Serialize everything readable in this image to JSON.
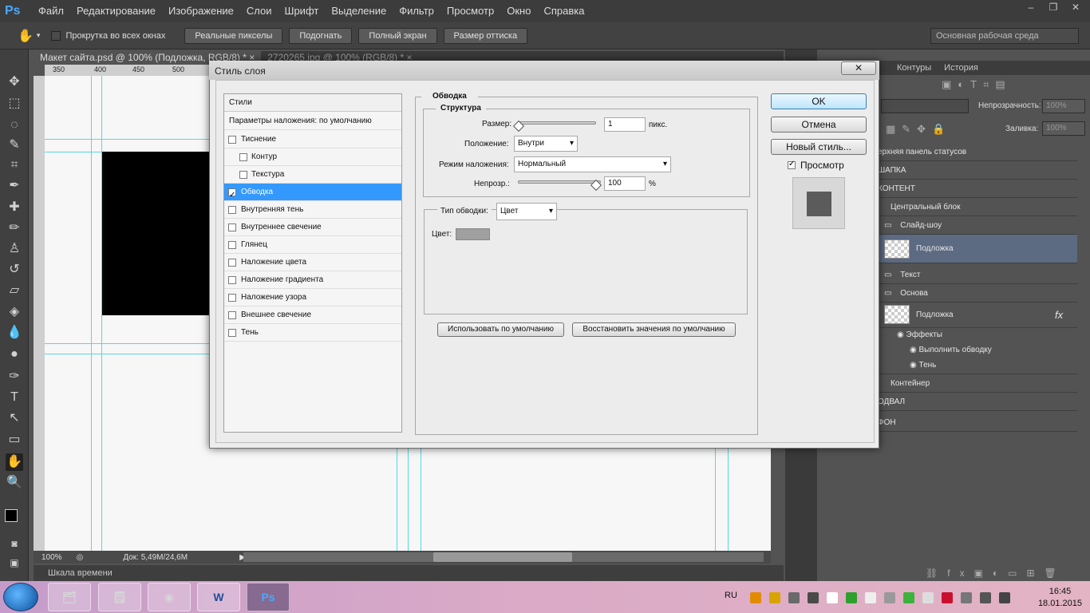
{
  "app": {
    "logo": "Ps"
  },
  "menu": [
    "Файл",
    "Редактирование",
    "Изображение",
    "Слои",
    "Шрифт",
    "Выделение",
    "Фильтр",
    "Просмотр",
    "Окно",
    "Справка"
  ],
  "options": {
    "scroll_all_label": "Прокрутка во всех окнах",
    "buttons": [
      "Реальные пикселы",
      "Подогнать",
      "Полный экран",
      "Размер оттиска"
    ],
    "workspace": "Основная рабочая среда"
  },
  "tabs": [
    {
      "label": "Макет сайта.psd @ 100% (Подложка, RGB/8) *"
    },
    {
      "label": "2720265.jpg @ 100% (RGB/8) *"
    }
  ],
  "rulers": {
    "top": [
      "350",
      "400",
      "450",
      "500"
    ]
  },
  "status": {
    "zoom": "100%",
    "doc": "Док: 5,49M/24,6M"
  },
  "timeline": "Шкала времени",
  "panel_tabs": [
    "Контуры",
    "История"
  ],
  "layers": {
    "opacity_label": "Непрозрачность:",
    "opacity_value": "100%",
    "fill_label": "Заливка:",
    "fill_value": "100%",
    "rows": [
      "ерхняя панель статусов",
      "ШАПКА",
      "КОНТЕНТ",
      "Центральный блок",
      "Слайд-шоу",
      "Подложка",
      "Текст",
      "Основа",
      "Подложка",
      "Эффекты",
      "Выполнить обводку",
      "Тень",
      "Контейнер",
      "ОДВАЛ",
      "ФОН"
    ],
    "fx": "fx"
  },
  "dialog": {
    "title": "Стиль слоя",
    "styles_header": "Стили",
    "blend_defaults": "Параметры наложения: по умолчанию",
    "styles": [
      {
        "label": "Тиснение",
        "checked": false
      },
      {
        "label": "Контур",
        "checked": false
      },
      {
        "label": "Текстура",
        "checked": false
      },
      {
        "label": "Обводка",
        "checked": true
      },
      {
        "label": "Внутренняя тень",
        "checked": false
      },
      {
        "label": "Внутреннее свечение",
        "checked": false
      },
      {
        "label": "Глянец",
        "checked": false
      },
      {
        "label": "Наложение цвета",
        "checked": false
      },
      {
        "label": "Наложение градиента",
        "checked": false
      },
      {
        "label": "Наложение узора",
        "checked": false
      },
      {
        "label": "Внешнее свечение",
        "checked": false
      },
      {
        "label": "Тень",
        "checked": false
      }
    ],
    "stroke": {
      "section_title": "Обводка",
      "structure_title": "Структура",
      "size_label": "Размер:",
      "size_value": "1",
      "size_unit": "пикс.",
      "size_level": 0.0,
      "position_label": "Положение:",
      "position_value": "Внутри",
      "blend_label": "Режим наложения:",
      "blend_value": "Нормальный",
      "opacity_label": "Непрозр.:",
      "opacity_value": "100",
      "opacity_unit": "%",
      "opacity_level": 1.0,
      "type_label": "Тип обводки:",
      "type_value": "Цвет",
      "color_label": "Цвет:",
      "color_value": "#a0a0a0",
      "make_default": "Использовать по умолчанию",
      "reset_default": "Восстановить значения по умолчанию"
    },
    "ok": "OK",
    "cancel": "Отмена",
    "new_style": "Новый стиль...",
    "preview_label": "Просмотр",
    "preview_checked": true
  },
  "taskbar": {
    "lang": "RU",
    "time": "16:45",
    "date": "18.01.2015"
  }
}
